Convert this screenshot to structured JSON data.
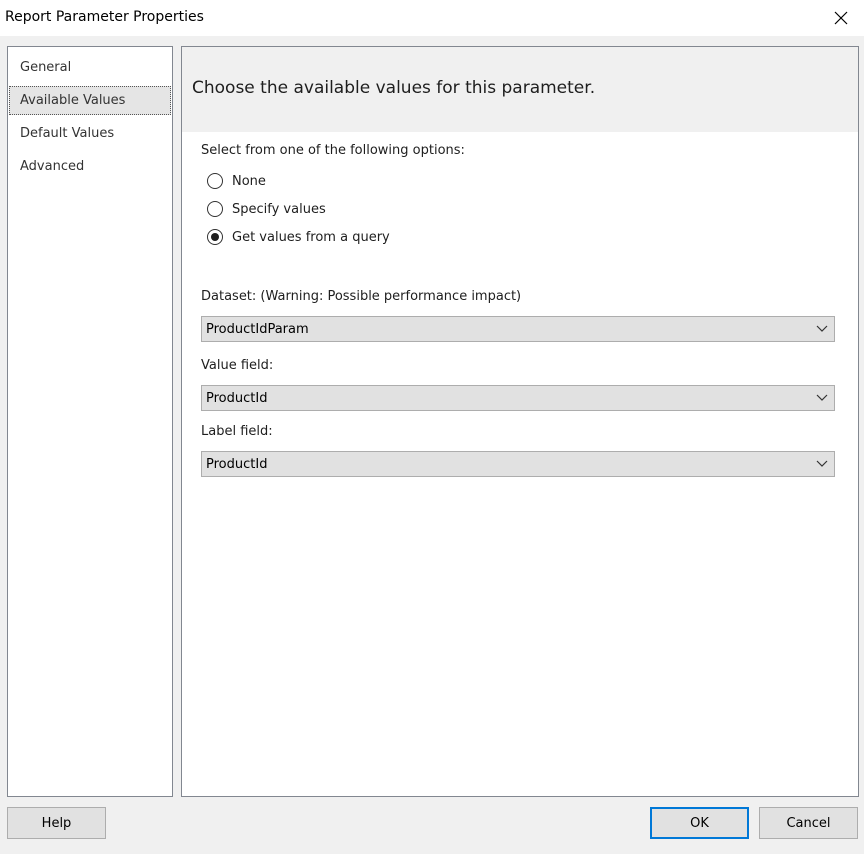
{
  "window": {
    "title": "Report Parameter Properties",
    "close_icon": "close-icon"
  },
  "nav": {
    "items": [
      {
        "label": "General",
        "selected": false
      },
      {
        "label": "Available Values",
        "selected": true
      },
      {
        "label": "Default Values",
        "selected": false
      },
      {
        "label": "Advanced",
        "selected": false
      }
    ]
  },
  "content": {
    "header": "Choose the available values for this parameter.",
    "instructions": "Select from one of the following options:",
    "options": [
      {
        "label": "None",
        "checked": false
      },
      {
        "label": "Specify values",
        "checked": false
      },
      {
        "label": "Get values from a query",
        "checked": true
      }
    ],
    "dataset": {
      "label": "Dataset: (Warning: Possible performance impact)",
      "value": "ProductIdParam"
    },
    "value_field": {
      "label": "Value field:",
      "value": "ProductId"
    },
    "label_field": {
      "label": "Label field:",
      "value": "ProductId"
    }
  },
  "buttons": {
    "help": "Help",
    "ok": "OK",
    "cancel": "Cancel"
  },
  "colors": {
    "accent": "#0078d7",
    "selected_nav": "#e5e5e5",
    "combo_bg": "#e1e1e1",
    "border": "#828790"
  }
}
